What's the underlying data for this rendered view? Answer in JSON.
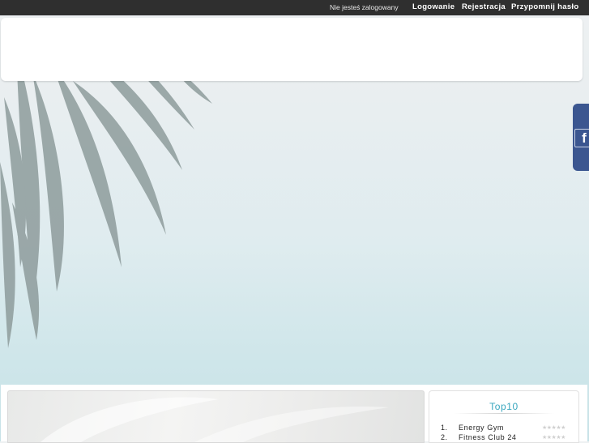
{
  "topbar": {
    "status": "Nie jesteś zalogowany",
    "login": "Logowanie",
    "register": "Rejestracja",
    "remind_password": "Przypomnij hasło"
  },
  "social": {
    "facebook_icon": "facebook-icon",
    "facebook_glyph": "f"
  },
  "top10": {
    "title": "Top10",
    "items": [
      {
        "rank": "1.",
        "name": "Energy Gym",
        "stars": "★★★★★",
        "rating": 0
      },
      {
        "rank": "2.",
        "name": "Fitness Club 24",
        "stars": "★★★★★",
        "rating": 0
      }
    ]
  },
  "colors": {
    "topbar_bg": "#2f2f2f",
    "facebook_blue": "#3b5690",
    "accent_title": "#3aa7bf"
  }
}
